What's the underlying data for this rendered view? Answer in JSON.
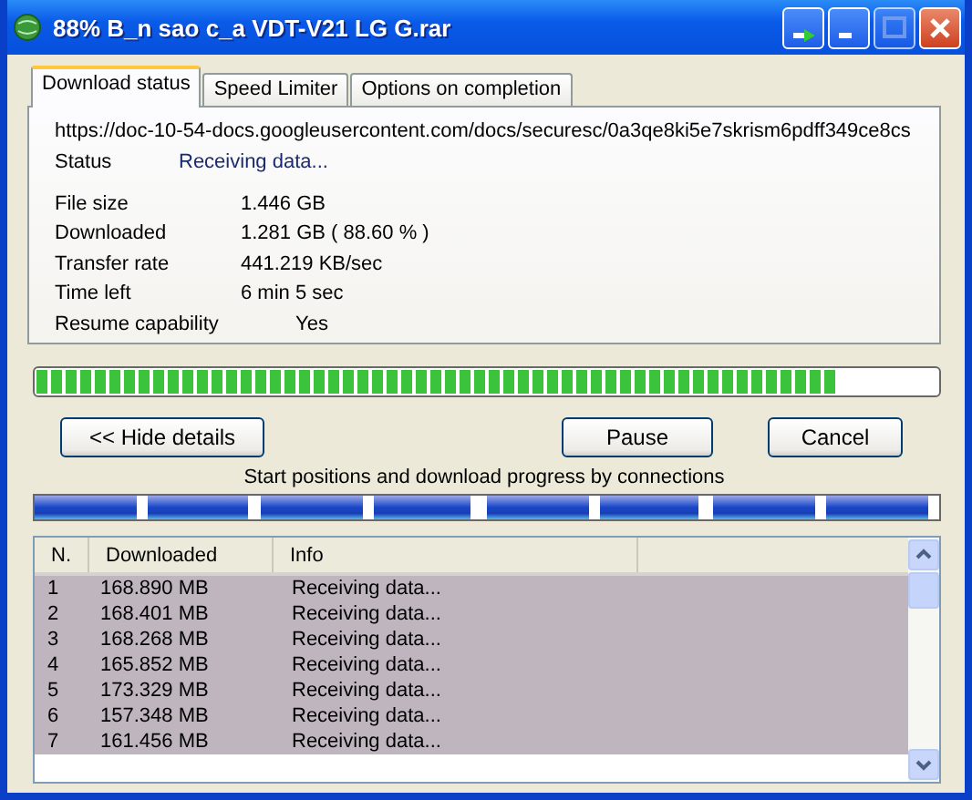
{
  "window": {
    "title": "88% B_n sao c_a VDT-V21 LG G.rar"
  },
  "tabs": [
    {
      "label": "Download status",
      "selected": true
    },
    {
      "label": "Speed Limiter",
      "selected": false
    },
    {
      "label": "Options on completion",
      "selected": false
    }
  ],
  "url": "https://doc-10-54-docs.googleusercontent.com/docs/securesc/0a3qe8ki5e7skrism6pdff349ce8cs",
  "status": {
    "label": "Status",
    "value": "Receiving data..."
  },
  "details": [
    {
      "label": "File size",
      "value": "1.446  GB"
    },
    {
      "label": "Downloaded",
      "value": "1.281  GB  ( 88.60 % )"
    },
    {
      "label": "Transfer rate",
      "value": "441.219  KB/sec"
    },
    {
      "label": "Time left",
      "value": "6 min 5 sec"
    },
    {
      "label": "Resume capability",
      "value": "Yes",
      "kind": "indented"
    }
  ],
  "progress": {
    "level": 0.886
  },
  "buttons": {
    "hide_details": "<< Hide details",
    "pause": "Pause",
    "cancel": "Cancel"
  },
  "connections_caption": "Start positions and download progress by connections",
  "connections": [
    {
      "level": 0.91
    },
    {
      "level": 0.88
    },
    {
      "level": 0.9
    },
    {
      "level": 0.86
    },
    {
      "level": 0.91
    },
    {
      "level": 0.87
    },
    {
      "level": 0.9
    },
    {
      "level": 0.91
    }
  ],
  "table": {
    "columns": [
      "N.",
      "Downloaded",
      "Info"
    ],
    "rows": [
      {
        "cells": [
          "1",
          "168.890  MB",
          "Receiving data..."
        ],
        "selected": true
      },
      {
        "cells": [
          "2",
          "168.401  MB",
          "Receiving data..."
        ],
        "selected": true
      },
      {
        "cells": [
          "3",
          "168.268  MB",
          "Receiving data..."
        ],
        "selected": true
      },
      {
        "cells": [
          "4",
          "165.852  MB",
          "Receiving data..."
        ],
        "selected": true
      },
      {
        "cells": [
          "5",
          "173.329  MB",
          "Receiving data..."
        ],
        "selected": true
      },
      {
        "cells": [
          "6",
          "157.348  MB",
          "Receiving data..."
        ],
        "selected": true
      },
      {
        "cells": [
          "7",
          "161.456  MB",
          "Receiving data..."
        ],
        "selected": true
      }
    ]
  }
}
